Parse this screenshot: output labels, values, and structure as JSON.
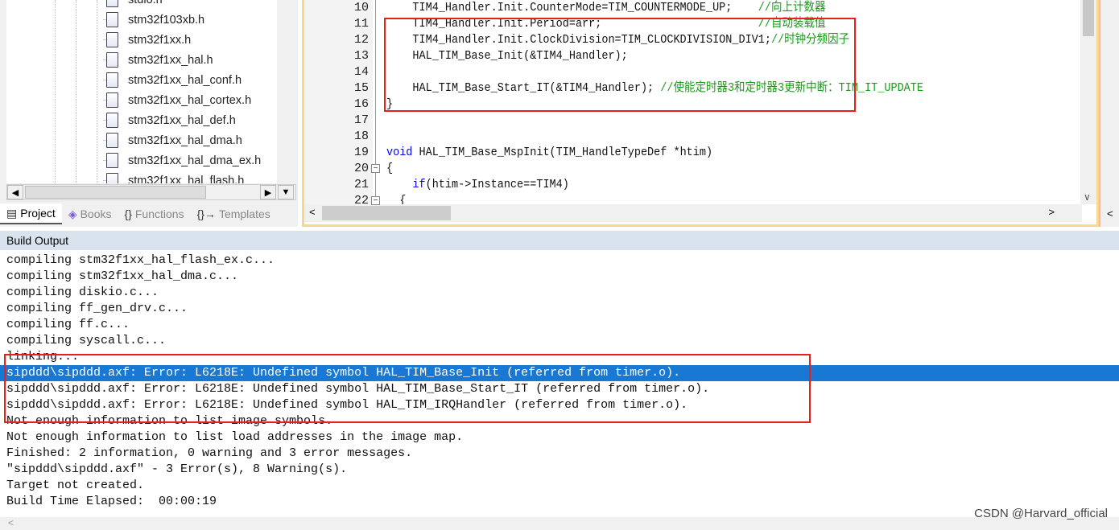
{
  "project_panel": {
    "files": [
      "stdio.h",
      "stm32f103xb.h",
      "stm32f1xx.h",
      "stm32f1xx_hal.h",
      "stm32f1xx_hal_conf.h",
      "stm32f1xx_hal_cortex.h",
      "stm32f1xx_hal_def.h",
      "stm32f1xx_hal_dma.h",
      "stm32f1xx_hal_dma_ex.h",
      "stm32f1xx_hal_flash.h"
    ],
    "tabs": [
      {
        "label": "Project",
        "icon": "project-icon",
        "active": true
      },
      {
        "label": "Books",
        "icon": "books-icon"
      },
      {
        "label": "Functions",
        "icon": "braces-icon"
      },
      {
        "label": "Templates",
        "icon": "templates-icon"
      }
    ]
  },
  "editor": {
    "lines": [
      {
        "n": "10",
        "code": "    TIM4_Handler.Init.CounterMode=TIM_COUNTERMODE_UP;    ",
        "comment": "//向上计数器"
      },
      {
        "n": "11",
        "code": "    TIM4_Handler.Init.Period=arr;                        ",
        "comment": "//自动装载值"
      },
      {
        "n": "12",
        "code": "    TIM4_Handler.Init.ClockDivision=TIM_CLOCKDIVISION_DIV1;",
        "comment": "//时钟分频因子"
      },
      {
        "n": "13",
        "code": "    HAL_TIM_Base_Init(&TIM4_Handler);",
        "comment": ""
      },
      {
        "n": "14",
        "code": "",
        "comment": ""
      },
      {
        "n": "15",
        "code": "    HAL_TIM_Base_Start_IT(&TIM4_Handler); ",
        "comment": "//使能定时器3和定时器3更新中断：TIM_IT_UPDATE"
      },
      {
        "n": "16",
        "code": "}",
        "comment": ""
      },
      {
        "n": "17",
        "code": "",
        "comment": ""
      },
      {
        "n": "18",
        "code": "",
        "comment": ""
      },
      {
        "n": "19",
        "kw": "void",
        "code": " HAL_TIM_Base_MspInit(TIM_HandleTypeDef *htim)",
        "comment": ""
      },
      {
        "n": "20",
        "code": "{",
        "comment": ""
      },
      {
        "n": "21",
        "kw": "    if",
        "code": "(htim->Instance==TIM4)",
        "comment": ""
      },
      {
        "n": "22",
        "code": "  {",
        "comment": ""
      }
    ]
  },
  "build_output": {
    "title": "Build Output",
    "lines": [
      "compiling stm32f1xx_hal_flash_ex.c...",
      "compiling stm32f1xx_hal_dma.c...",
      "compiling diskio.c...",
      "compiling ff_gen_drv.c...",
      "compiling ff.c...",
      "compiling syscall.c...",
      "linking...",
      "sipddd\\sipddd.axf: Error: L6218E: Undefined symbol HAL_TIM_Base_Init (referred from timer.o).",
      "sipddd\\sipddd.axf: Error: L6218E: Undefined symbol HAL_TIM_Base_Start_IT (referred from timer.o).",
      "sipddd\\sipddd.axf: Error: L6218E: Undefined symbol HAL_TIM_IRQHandler (referred from timer.o).",
      "Not enough information to list image symbols.",
      "Not enough information to list load addresses in the image map.",
      "Finished: 2 information, 0 warning and 3 error messages.",
      "\"sipddd\\sipddd.axf\" - 3 Error(s), 8 Warning(s).",
      "Target not created.",
      "Build Time Elapsed:  00:00:19"
    ],
    "selected_index": 7
  },
  "watermark": "CSDN @Harvard_official",
  "colors": {
    "selection": "#1978d4",
    "highlight_box": "#e8201a",
    "comment": "#1a9a1a",
    "keyword": "#0000ff"
  }
}
